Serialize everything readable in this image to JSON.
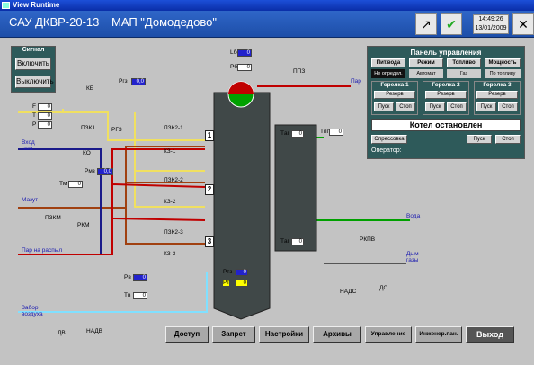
{
  "window": {
    "title": "View Runtime"
  },
  "header": {
    "app_title": "САУ ДКВР-20-13",
    "site_title": "МАП \"Домодедово\"",
    "time": "14:49:26",
    "date": "13/01/2009"
  },
  "signal": {
    "title": "Сигнал",
    "on": "Включить",
    "off": "Выключить"
  },
  "control_panel": {
    "title": "Панель управления",
    "tabs": [
      "Пит.вода",
      "Режим",
      "Топливо",
      "Мощность"
    ],
    "modes": [
      "Не определ.",
      "Автомат",
      "Газ",
      "По топливу"
    ],
    "burners": [
      {
        "name": "Горелка 1",
        "reserve": "Резерв",
        "start": "Пуск",
        "stop": "Стоп"
      },
      {
        "name": "Горелка 2",
        "reserve": "Резерв",
        "start": "Пуск",
        "stop": "Стоп"
      },
      {
        "name": "Горелка 3",
        "reserve": "Резерв",
        "start": "Пуск",
        "stop": "Стоп"
      }
    ],
    "status": "Котел остановлен",
    "pressurize": "Опрессовка",
    "start": "Пуск",
    "stop": "Стоп",
    "operator": "Оператор:"
  },
  "labels": {
    "gas_in": "Вход\nгаза",
    "mazut": "Мазут",
    "steam_spray": "Пар на распыл",
    "air_in": "Забор\nвоздуха",
    "steam": "Пар",
    "water": "Вода",
    "smoke": "Дым\nгазы",
    "kb": "КБ",
    "pzk1": "ПЗК1",
    "ko": "КО",
    "rg3": "РГЗ",
    "pzk21": "ПЗК2-1",
    "kz1": "КЗ-1",
    "pzk22": "ПЗК2-2",
    "kz2": "КЗ-2",
    "pzk23": "ПЗК2-3",
    "kz3": "КЗ-3",
    "pzkm": "ПЗКМ",
    "rkm": "РКМ",
    "ppz": "ППЗ",
    "rkpv": "РКПВ",
    "nads": "НАДС",
    "ds": "ДС",
    "nadv": "НАДВ",
    "dv": "ДВ",
    "sec1": "1",
    "sec2": "2",
    "sec3": "3"
  },
  "readings": {
    "P": "P",
    "T": "T",
    "F": "F",
    "L": "L",
    "Pg": "Pгз",
    "Pmz": "Pмз",
    "Tm": "Tм",
    "Tpp": "Tпп",
    "Tag": "Tаг",
    "Prt": "Pтз",
    "Pt": "Pт",
    "Pv": "Pв",
    "Tv": "Tв",
    "Lbs": "Lбс",
    "Pb": "Pб",
    "zero": "0",
    "zero_dec": "0,0",
    "pct": "0%",
    "mpa": "МПа",
    "kpa": "кПа",
    "c": "°C",
    "th": "т/ч",
    "m3h": "м³/ч",
    "mm": "мм",
    "pa": "Па"
  },
  "footer": [
    "Доступ",
    "Запрет",
    "Настройки",
    "Архивы",
    "Управление",
    "Инженер.пан.",
    "Выход"
  ],
  "colors": {
    "gas": "#f0e060",
    "mazut": "#b04010",
    "steam_red": "#c00000",
    "water": "#00a000",
    "air": "#80e0ff",
    "boiler": "#404848"
  }
}
